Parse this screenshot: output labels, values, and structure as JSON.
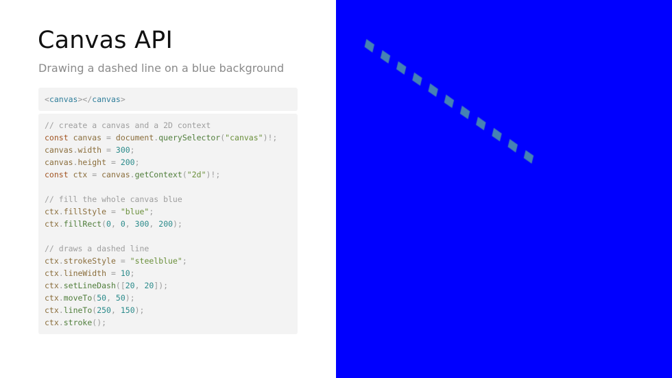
{
  "header": {
    "title": "Canvas API",
    "subtitle": "Drawing a dashed line on a blue background"
  },
  "html_snippet": {
    "open_tag_lt": "<",
    "tag_name": "canvas",
    "open_tag_gt": ">",
    "close_tag_lt": "</",
    "close_tag_gt": ">"
  },
  "js_snippet": {
    "lines": [
      "// create a canvas and a 2D context",
      "const canvas = document.querySelector(\"canvas\")!;",
      "canvas.width = 300;",
      "canvas.height = 200;",
      "const ctx = canvas.getContext(\"2d\")!;",
      "",
      "// fill the whole canvas blue",
      "ctx.fillStyle = \"blue\";",
      "ctx.fillRect(0, 0, 300, 200);",
      "",
      "// draws a dashed line",
      "ctx.strokeStyle = \"steelblue\";",
      "ctx.lineWidth = 10;",
      "ctx.setLineDash([20, 20]);",
      "ctx.moveTo(50, 50);",
      "ctx.lineTo(250, 150);",
      "ctx.stroke();"
    ]
  },
  "preview": {
    "background_color": "#0000ff",
    "stroke_color": "#4682b4",
    "line_from": [
      50,
      50
    ],
    "line_to": [
      250,
      150
    ],
    "line_width": 10,
    "dash": [
      20,
      20
    ]
  }
}
